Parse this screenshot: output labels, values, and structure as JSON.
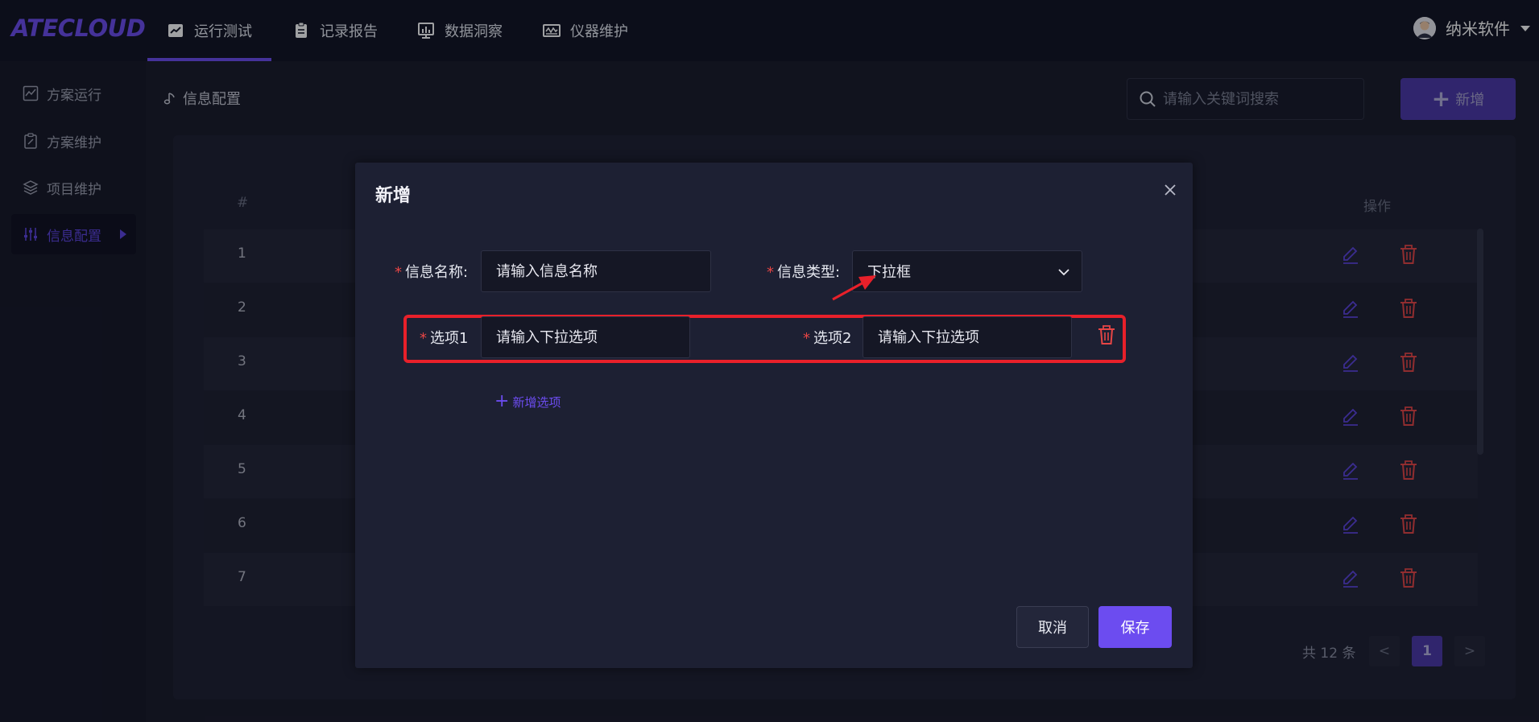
{
  "app": {
    "logo": "ATECLOUD"
  },
  "nav": {
    "items": [
      {
        "label": "运行测试",
        "icon": "line-chart-icon",
        "active": true
      },
      {
        "label": "记录报告",
        "icon": "clipboard-icon",
        "active": false
      },
      {
        "label": "数据洞察",
        "icon": "monitor-chart-icon",
        "active": false
      },
      {
        "label": "仪器维护",
        "icon": "instrument-icon",
        "active": false
      }
    ]
  },
  "user": {
    "name": "纳米软件",
    "icon": "avatar-icon"
  },
  "sidebar": {
    "items": [
      {
        "label": "方案运行",
        "icon": "chart-box-icon",
        "active": false
      },
      {
        "label": "方案维护",
        "icon": "clipboard-edit-icon",
        "active": false
      },
      {
        "label": "项目维护",
        "icon": "layers-icon",
        "active": false
      },
      {
        "label": "信息配置",
        "icon": "sliders-icon",
        "active": true
      }
    ]
  },
  "page": {
    "title": "信息配置",
    "search_placeholder": "请输入关键词搜索",
    "add_label": "新增"
  },
  "table": {
    "headers": {
      "index": "#",
      "actions": "操作"
    },
    "rows": [
      "1",
      "2",
      "3",
      "4",
      "5",
      "6",
      "7"
    ]
  },
  "pagination": {
    "total_text": "共 12 条",
    "current": "1",
    "prev": "<",
    "next": ">"
  },
  "modal": {
    "title": "新增",
    "name_label": "信息名称:",
    "name_placeholder": "请输入信息名称",
    "type_label": "信息类型:",
    "type_value": "下拉框",
    "option1_label": "选项1",
    "option1_placeholder": "请输入下拉选项",
    "option2_label": "选项2",
    "option2_placeholder": "请输入下拉选项",
    "add_option_label": "新增选项",
    "cancel_label": "取消",
    "save_label": "保存",
    "required_mark": "*"
  },
  "colors": {
    "accent": "#6c4cf0",
    "danger": "#e64545",
    "highlight": "#e8202a",
    "background": "#1a1c2a"
  }
}
